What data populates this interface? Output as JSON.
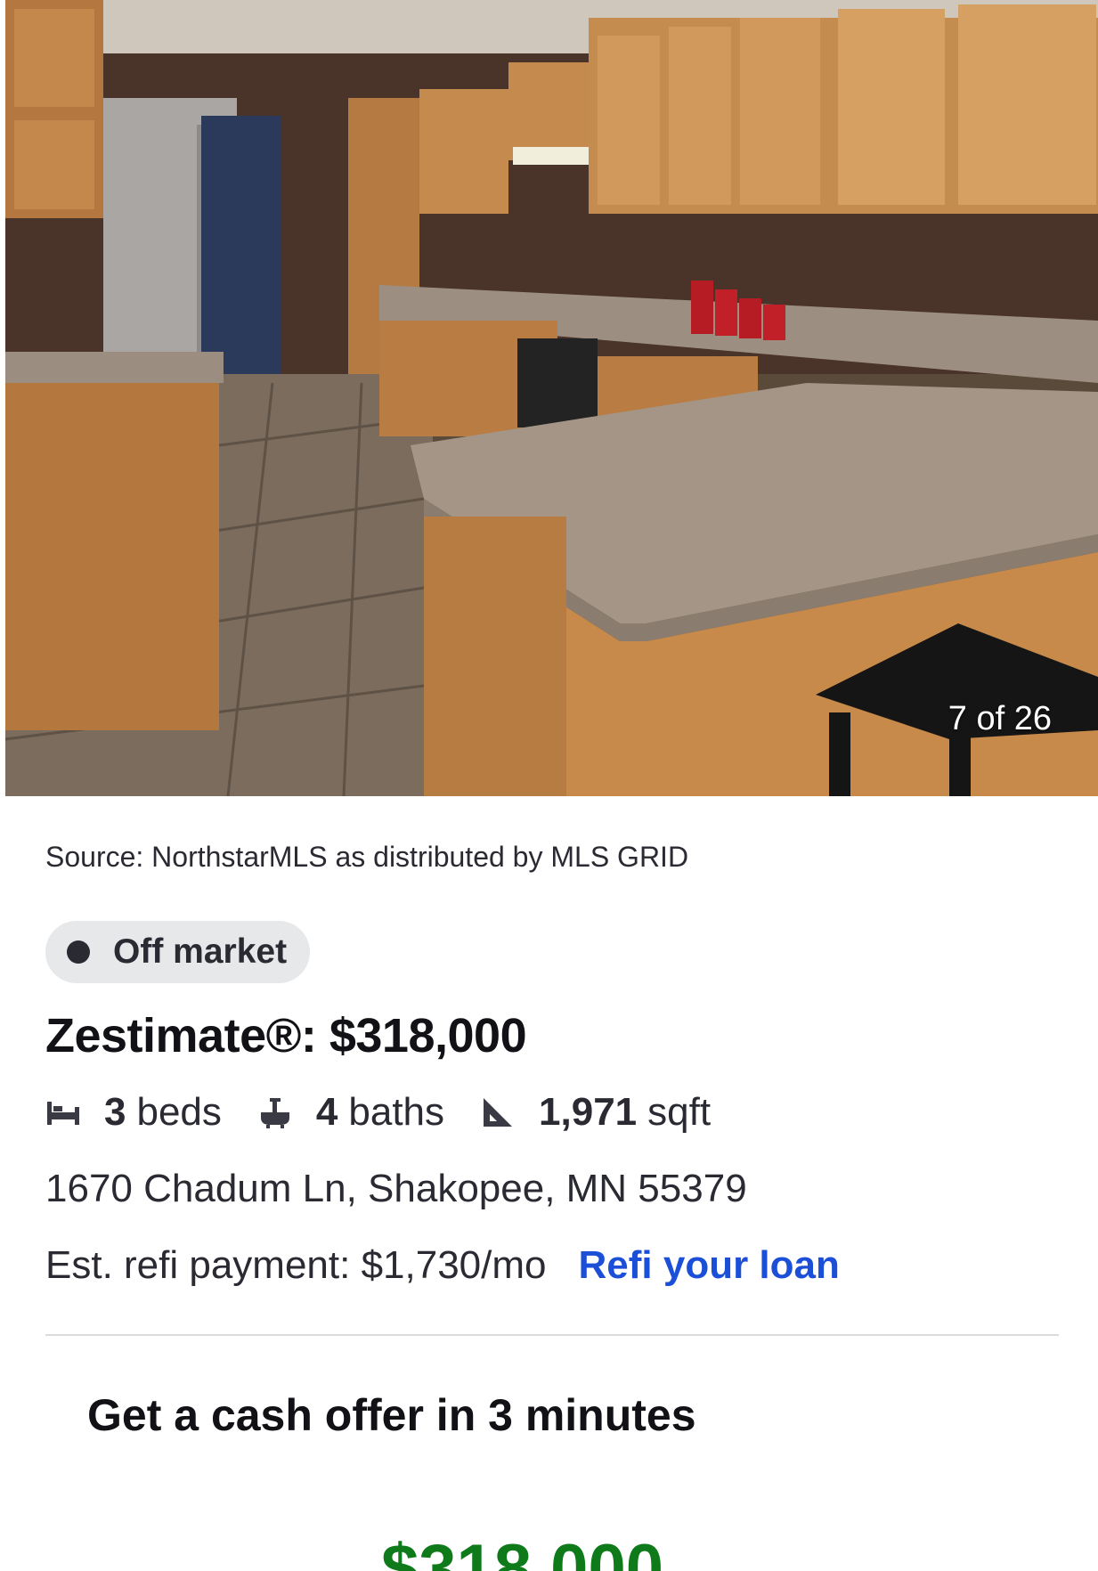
{
  "photo": {
    "counter": "7 of 26"
  },
  "source": "Source: NorthstarMLS as distributed by MLS GRID",
  "status": {
    "label": "Off market"
  },
  "zestimate": "Zestimate®: $318,000",
  "facts": {
    "beds_num": "3",
    "beds_label": "beds",
    "baths_num": "4",
    "baths_label": "baths",
    "sqft_num": "1,971",
    "sqft_label": "sqft"
  },
  "address": "1670 Chadum Ln, Shakopee, MN 55379",
  "refi": {
    "text": "Est. refi payment: $1,730/mo",
    "link": "Refi your loan"
  },
  "cash_offer": {
    "heading": "Get a cash offer in 3 minutes",
    "value": "$318,000"
  },
  "colors": {
    "link": "#1b4fd8",
    "cash_value": "#0e7a1a",
    "badge_bg": "#e6e8ea"
  }
}
